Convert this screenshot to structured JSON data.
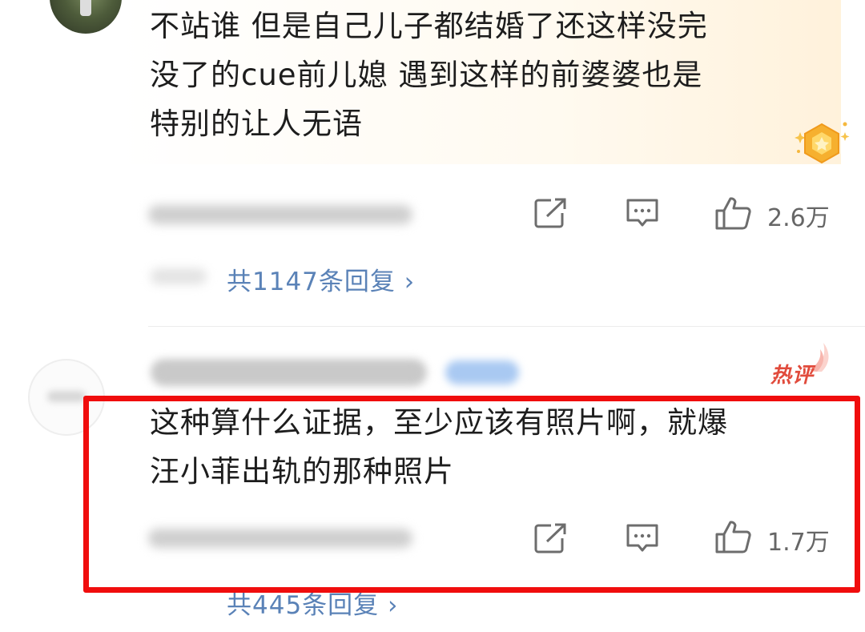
{
  "comments": [
    {
      "text_lines": [
        "不站谁 但是自己儿子都结婚了还这样没完",
        "没了的cue前儿媳 遇到这样的前婆婆也是",
        "特别的让人无语"
      ],
      "like_count": "2.6万",
      "reply_link": "共1147条回复 ›"
    },
    {
      "badge": "热评",
      "text_lines": [
        "这种算什么证据，至少应该有照片啊，就爆",
        "汪小菲出轨的那种照片"
      ],
      "like_count": "1.7万",
      "reply_link": "共445条回复 ›"
    }
  ],
  "icons": {
    "share": "share-icon",
    "comment": "comment-icon",
    "like": "thumbs-up-icon",
    "medal": "star-medal-icon"
  },
  "colors": {
    "highlight_border": "#f00d0d",
    "link": "#5a82b7",
    "hot_badge": "#e14b3c"
  }
}
